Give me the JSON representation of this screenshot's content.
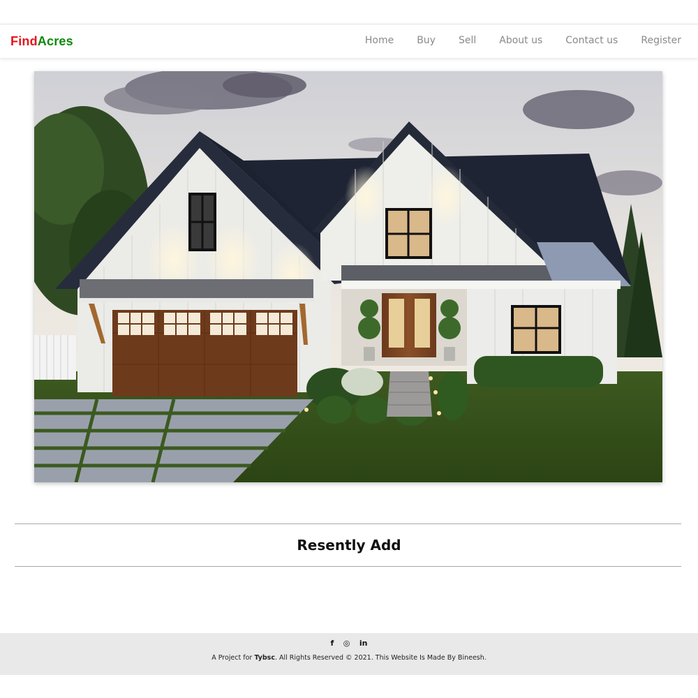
{
  "brand": {
    "part1": "Find",
    "part2": "Acres"
  },
  "nav": {
    "items": [
      {
        "label": "Home"
      },
      {
        "label": "Buy"
      },
      {
        "label": "Sell"
      },
      {
        "label": "About us"
      },
      {
        "label": "Contact us"
      },
      {
        "label": "Register"
      }
    ]
  },
  "hero": {
    "image": "house-photo"
  },
  "section": {
    "title": "Resently Add"
  },
  "footer": {
    "social": [
      {
        "icon": "facebook-icon",
        "glyph": "f"
      },
      {
        "icon": "instagram-icon",
        "glyph": "◎"
      },
      {
        "icon": "linkedin-icon",
        "glyph": "in"
      }
    ],
    "text_prefix": "A Project for ",
    "text_bold": "Tybsc",
    "text_suffix": ". All Rights Reserved © 2021. This Website Is Made By Bineesh."
  },
  "colors": {
    "brand_find": "#e8141b",
    "brand_acres": "#0d8a0d",
    "nav_text": "#8a8a8a",
    "footer_bg": "#e9e9e9"
  }
}
